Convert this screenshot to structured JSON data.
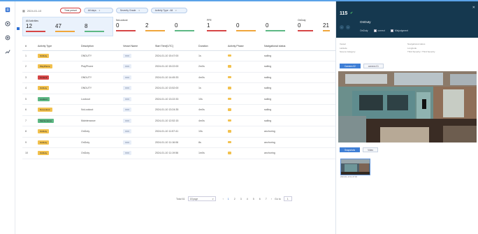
{
  "filters": {
    "date": "2024-01-10",
    "time_preset": "Time preset",
    "all_days": "All days",
    "severity": "Severity Grade",
    "activity_type": "Activity Type : All"
  },
  "summary": [
    {
      "label": "All Activities",
      "values": [
        "12",
        "47",
        "8"
      ]
    },
    {
      "label": "NoLookout",
      "values": [
        "0",
        "2",
        "0"
      ]
    },
    {
      "label": "PPE",
      "values": [
        "1",
        "0",
        "0"
      ]
    },
    {
      "label": "OnDuty",
      "values": [
        "0",
        "21"
      ]
    }
  ],
  "colors": {
    "red": "#d64545",
    "orange": "#f0a63b",
    "green": "#5db884",
    "accent": "#3f7fd6",
    "header_dark": "#15384f"
  },
  "table": {
    "headers": [
      "#",
      "Activity Type",
      "Description",
      "Vessel Name",
      "Start Time[UTC]",
      "Duration",
      "Activity Phase",
      "Navigational status"
    ],
    "rows": [
      {
        "num": "1",
        "type": "OnDuty",
        "type_color": "#f2c14e",
        "desc": "ONDUTY",
        "vessel": "XXX",
        "start": "2024-01-10 15:47:00",
        "duration": "1s",
        "nav": "sailing"
      },
      {
        "num": "2",
        "type": "PlayPhone",
        "type_color": "#f2c14e",
        "desc": "PlayPhone",
        "vessel": "XXX",
        "start": "2024-01-10 15:22:00",
        "duration": "2m0s",
        "nav": "sailing"
      },
      {
        "num": "3",
        "type": "Ondeck",
        "type_color": "#d64545",
        "desc": "ONDUTY",
        "vessel": "XXX",
        "start": "2024-01-10 14:45:33",
        "duration": "4m0s",
        "nav": "sailing"
      },
      {
        "num": "4",
        "type": "OnDuty",
        "type_color": "#f2c14e",
        "desc": "ONDUTY",
        "vessel": "XXX",
        "start": "2024-01-10 13:52:00",
        "duration": "1s",
        "nav": "sailing"
      },
      {
        "num": "5",
        "type": "Lookout",
        "type_color": "#5db884",
        "desc": "Lookout",
        "vessel": "XXX",
        "start": "2024-01-10 13:22:33",
        "duration": "10s",
        "nav": "sailing"
      },
      {
        "num": "6",
        "type": "NoLookout",
        "type_color": "#f2c14e",
        "desc": "NoLookout",
        "vessel": "XXX",
        "start": "2024-01-10 13:24:35",
        "duration": "4m0s",
        "nav": "sailing"
      },
      {
        "num": "7",
        "type": "Maintenance",
        "type_color": "#5db884",
        "desc": "Maintenance",
        "vessel": "XXX",
        "start": "2024-01-10 12:52:15",
        "duration": "4m0s",
        "nav": "sailing"
      },
      {
        "num": "8",
        "type": "OnDuty",
        "type_color": "#f2c14e",
        "desc": "OnDuty",
        "vessel": "XXX",
        "start": "2024-01-10 11:57:41",
        "duration": "10s",
        "nav": "anchoring"
      },
      {
        "num": "9",
        "type": "OnDuty",
        "type_color": "#f2c14e",
        "desc": "OnDuty",
        "vessel": "XXX",
        "start": "2024-01-10 11:16:06",
        "duration": "8s",
        "nav": "anchoring"
      },
      {
        "num": "10",
        "type": "OnDuty",
        "type_color": "#f2c14e",
        "desc": "OnDuty",
        "vessel": "XXX",
        "start": "2024-01-10 11:19:56",
        "duration": "1m0s",
        "nav": "anchoring"
      }
    ]
  },
  "pagination": {
    "total": "Total 61",
    "page_size": "10/page",
    "pages": [
      "1",
      "2",
      "3",
      "4",
      "5",
      "6",
      "7"
    ],
    "goto": "Go to",
    "goto_value": "1"
  },
  "detail": {
    "id": "115",
    "title": "OnDuty",
    "sub_type": "OnDuty",
    "check_correct": "correct",
    "check_misjudgment": "Misjudgment",
    "kv": [
      [
        "Vessel",
        "Navigational status"
      ],
      [
        "Latitude",
        "Longitude"
      ],
      [
        "Severe Category",
        "Third Severity / Third Severity"
      ]
    ],
    "tabs": [
      "Camera 02",
      "camera 01"
    ],
    "media_tabs": [
      "Snapshots",
      "Video"
    ],
    "thumb_caption": "2024-01-10 11:47:00"
  }
}
